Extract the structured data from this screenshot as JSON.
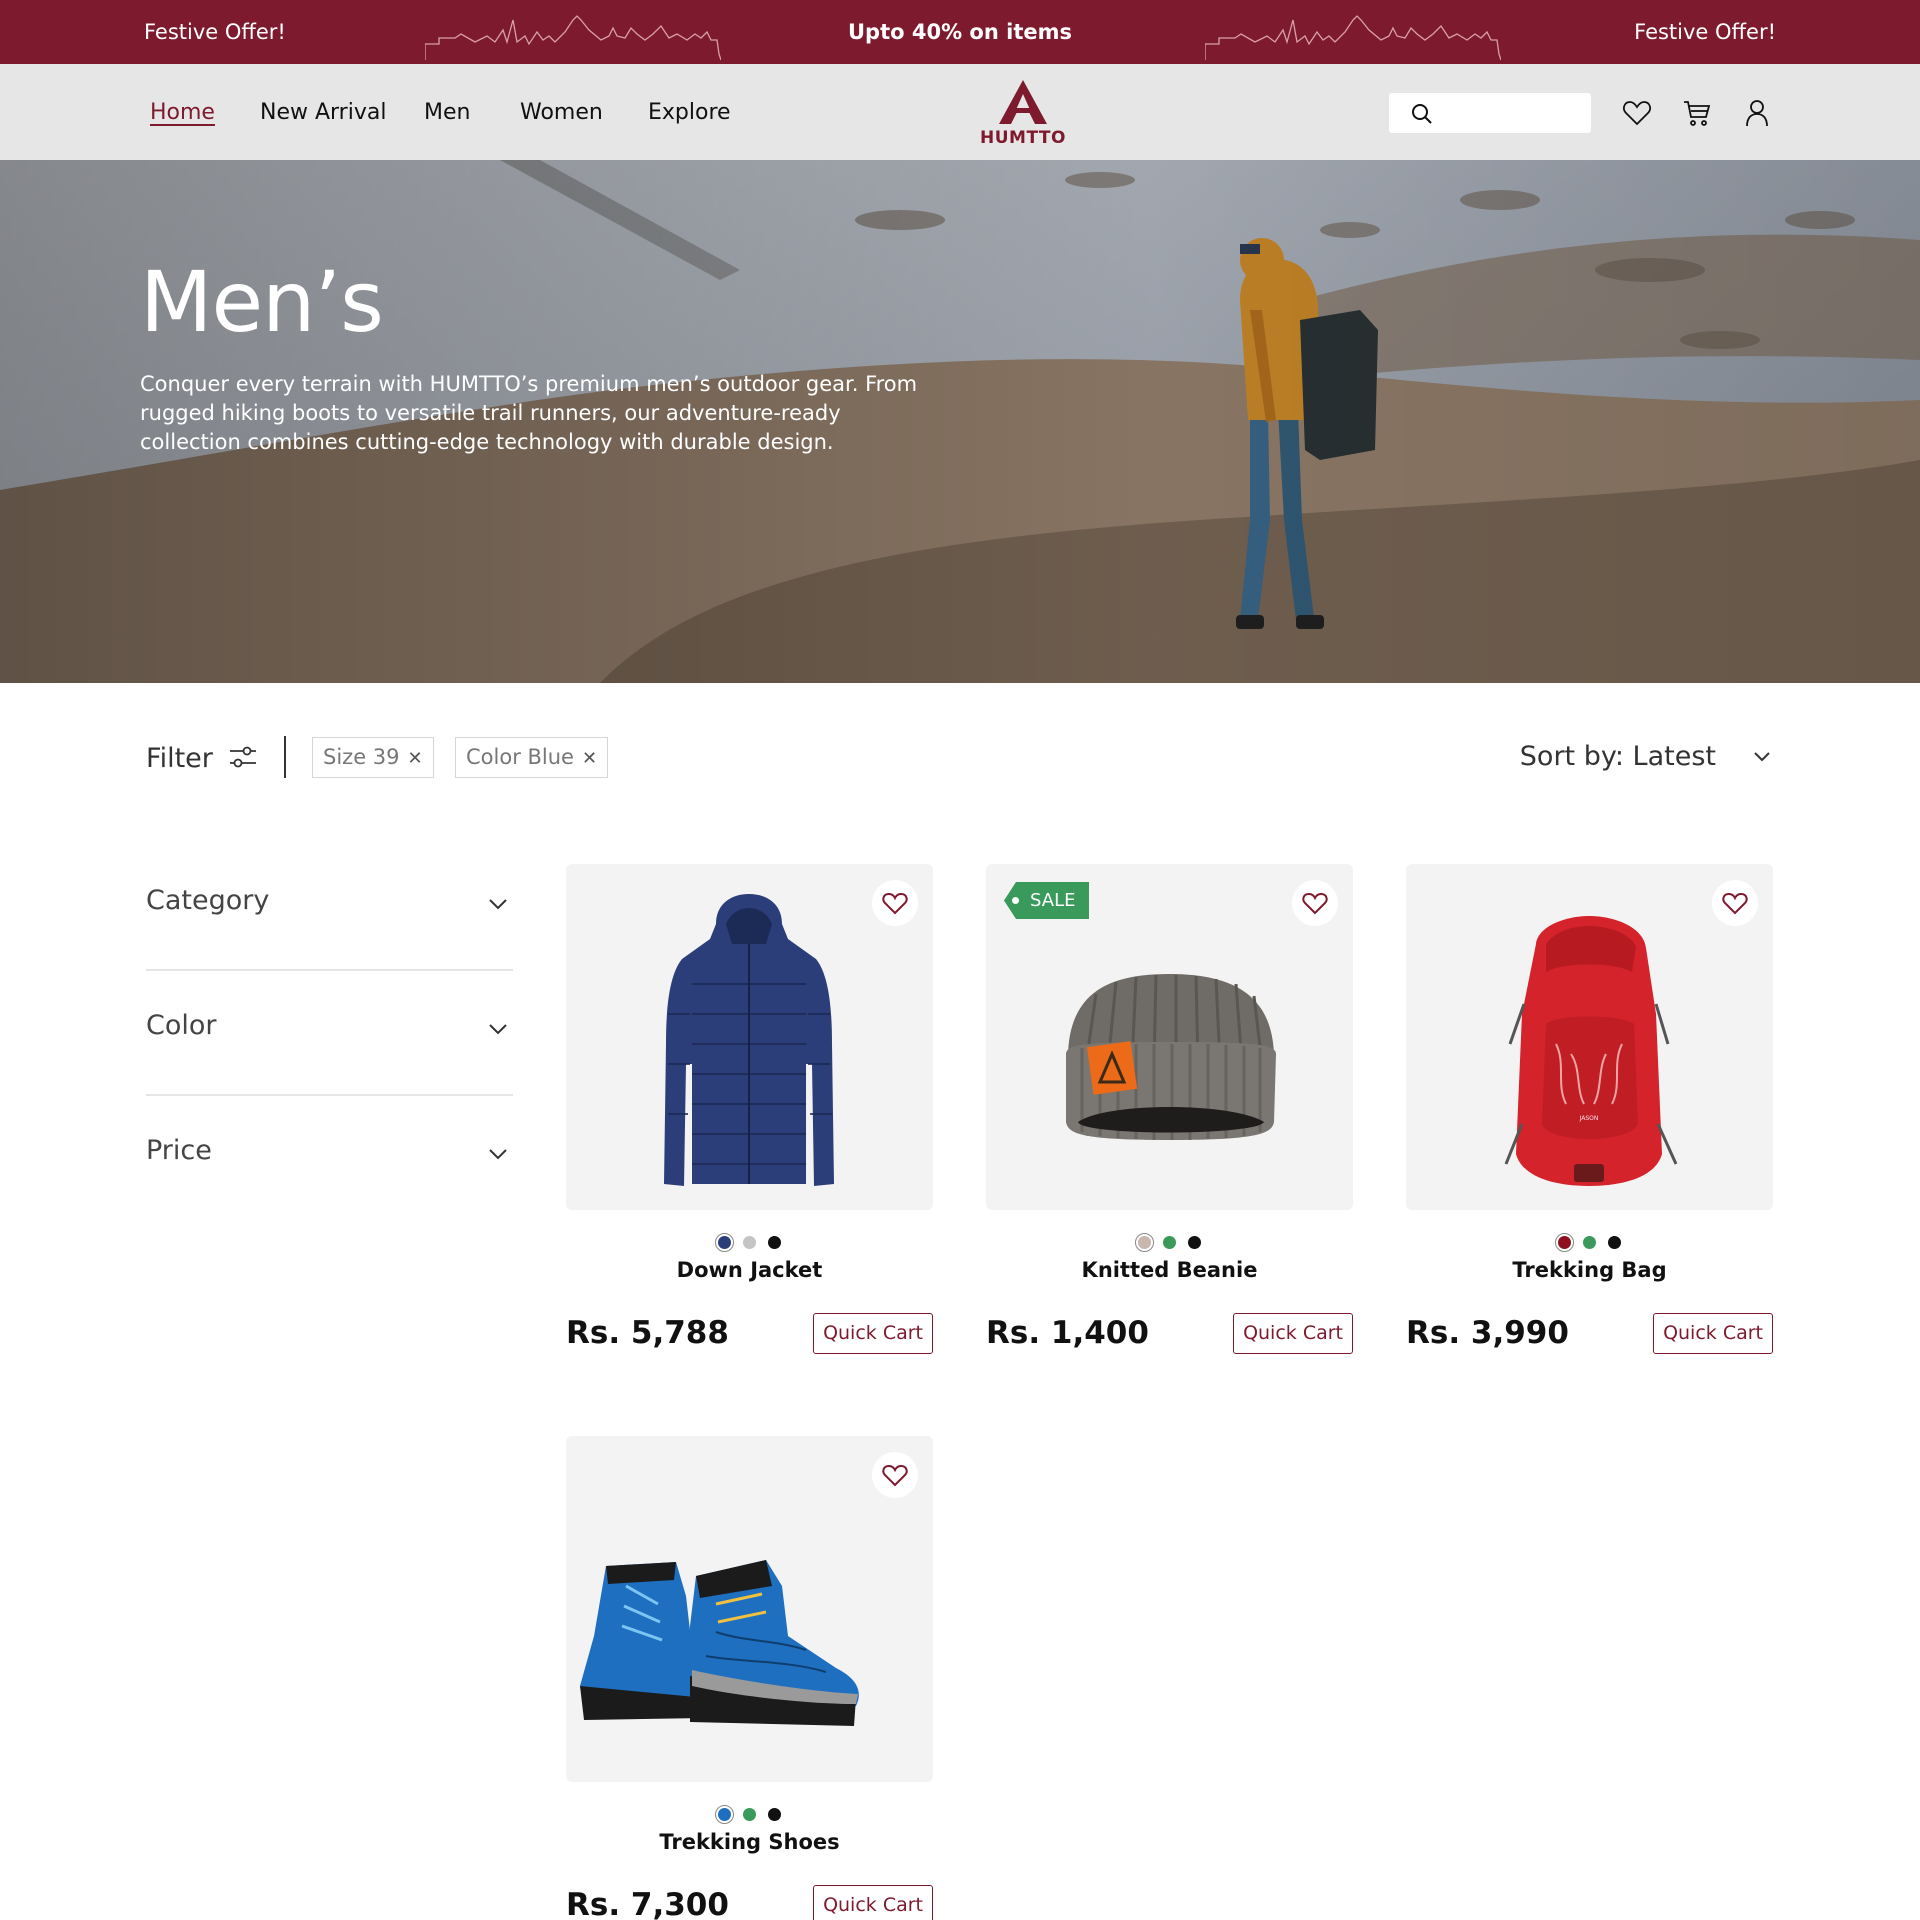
{
  "promo": {
    "left": "Festive Offer!",
    "center": "Upto 40% on items",
    "right": "Festive Offer!"
  },
  "nav": {
    "links": [
      "Home",
      "New Arrival",
      "Men",
      "Women",
      "Explore"
    ],
    "active": "Home",
    "brand": "HUMTTO",
    "search_placeholder": ""
  },
  "hero": {
    "title": "Men’s",
    "description": "Conquer every terrain with HUMTTO’s premium men’s outdoor gear. From rugged hiking boots to versatile trail runners, our adventure-ready collection combines cutting-edge technology with durable design."
  },
  "filters": {
    "label": "Filter",
    "chips": [
      "Size 39",
      "Color Blue"
    ],
    "sort_label": "Sort by: Latest"
  },
  "sidebar": {
    "sections": [
      "Category",
      "Color",
      "Price"
    ]
  },
  "products": [
    {
      "name": "Down Jacket",
      "price": "Rs. 5,788",
      "sale": false,
      "colors": [
        "#2c3e7a",
        "#c4c4c4",
        "#111111"
      ],
      "button": "Quick Cart"
    },
    {
      "name": "Knitted Beanie",
      "price": "Rs. 1,400",
      "sale": true,
      "sale_label": "SALE",
      "colors": [
        "#c9b6ae",
        "#3a9a5b",
        "#111111"
      ],
      "button": "Quick Cart"
    },
    {
      "name": "Trekking Bag",
      "price": "Rs. 3,990",
      "sale": false,
      "colors": [
        "#8e1020",
        "#3a9a5b",
        "#111111"
      ],
      "button": "Quick Cart"
    },
    {
      "name": "Trekking Shoes",
      "price": "Rs. 7,300",
      "sale": false,
      "colors": [
        "#1e6fc0",
        "#3a9a5b",
        "#111111"
      ],
      "button": "Quick Cart"
    }
  ],
  "theme": {
    "brand": "#7e1a2e",
    "sale": "#3a9a5b"
  }
}
